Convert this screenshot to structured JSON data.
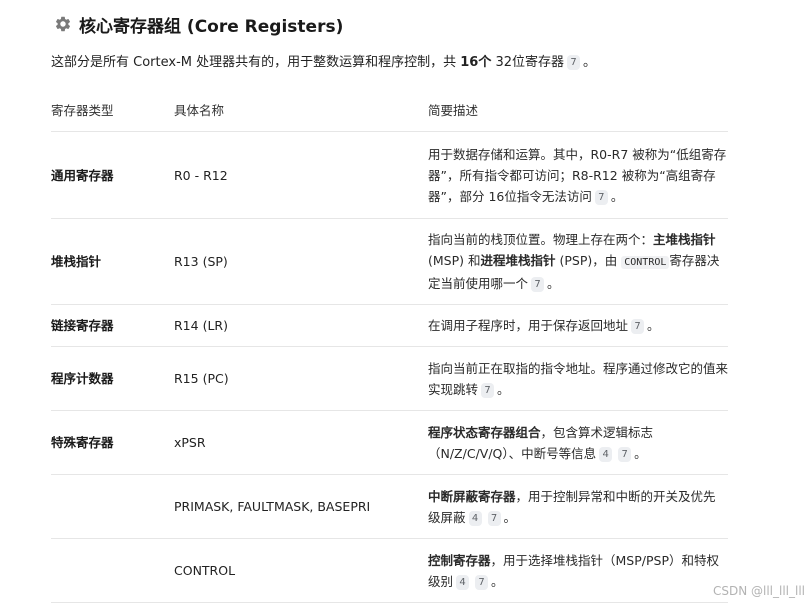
{
  "section": {
    "icon": "gear-icon",
    "title": "核心寄存器组 (Core Registers)"
  },
  "intro": {
    "text_1": "这部分是所有 Cortex-M 处理器共有的，用于整数运算和程序控制，共",
    "count": "16个",
    "text_2": "32位寄存器",
    "cite": "7",
    "end": "。"
  },
  "table": {
    "headers": [
      "寄存器类型",
      "具体名称",
      "简要描述"
    ],
    "rows": [
      {
        "type": "通用寄存器",
        "name": "R0 - R12",
        "desc_1": "用于数据存储和运算。其中，R0-R7 被称为“低组寄存器”，所有指令都可访问；R8-R12 被称为“高组寄存器”，部分 16位指令无法访问",
        "cites": [
          "7"
        ],
        "end": "。"
      },
      {
        "type": "堆栈指针",
        "name": "R13 (SP)",
        "desc_1": "指向当前的栈顶位置。物理上存在两个：",
        "bold_1": "主堆栈指针",
        "desc_2": " (MSP) 和",
        "bold_2": "进程堆栈指针",
        "desc_3": " (PSP)，由",
        "code": "CONTROL",
        "desc_4": "寄存器决定当前使用哪一个",
        "cites": [
          "7"
        ],
        "end": "。"
      },
      {
        "type": "链接寄存器",
        "name": "R14 (LR)",
        "desc_1": "在调用子程序时，用于保存返回地址",
        "cites": [
          "7"
        ],
        "end": "。"
      },
      {
        "type": "程序计数器",
        "name": "R15 (PC)",
        "desc_1": "指向当前正在取指的指令地址。程序通过修改它的值来实现跳转",
        "cites": [
          "7"
        ],
        "end": "。"
      },
      {
        "type": "特殊寄存器",
        "name": "xPSR",
        "bold": "程序状态寄存器组合",
        "desc_1": "，包含算术逻辑标志（N/Z/C/V/Q）、中断号等信息",
        "cites": [
          "4",
          "7"
        ],
        "end": "。"
      },
      {
        "type": "",
        "name": "PRIMASK, FAULTMASK, BASEPRI",
        "bold": "中断屏蔽寄存器",
        "desc_1": "，用于控制异常和中断的开关及优先级屏蔽",
        "cites": [
          "4",
          "7"
        ],
        "end": "。"
      },
      {
        "type": "",
        "name": "CONTROL",
        "bold": "控制寄存器",
        "desc_1": "，用于选择堆栈指针（MSP/PSP）和特权级别",
        "cites": [
          "4",
          "7"
        ],
        "end": "。"
      }
    ]
  },
  "watermark": "CSDN @lll_lll_lll"
}
